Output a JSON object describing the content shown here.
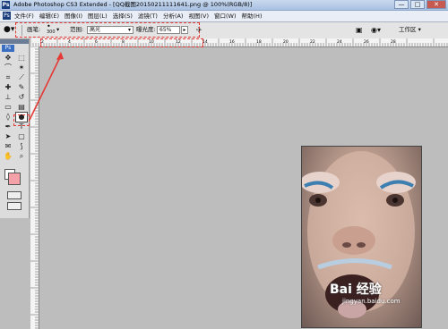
{
  "titlebar": {
    "logo": "Ps",
    "title": "Adobe Photoshop CS3 Extended - [QQ截图20150211111641.png @ 100%(RGB/8)]",
    "buttons": [
      "—",
      "□",
      "✕"
    ]
  },
  "menubar": {
    "items": [
      "文件(F)",
      "编辑(E)",
      "图像(I)",
      "图层(L)",
      "选择(S)",
      "滤镜(T)",
      "分析(A)",
      "视图(V)",
      "窗口(W)",
      "帮助(H)"
    ]
  },
  "options": {
    "brush_label": "画笔:",
    "brush_size": "300",
    "range_label": "范围:",
    "range_value": "高光",
    "exposure_label": "曝光度:",
    "exposure_value": "65%",
    "workspace": "工作区 ▾"
  },
  "ruler": {
    "ticks": [
      "2",
      "4",
      "6",
      "8",
      "10",
      "12",
      "14",
      "16",
      "18",
      "20",
      "22",
      "24",
      "26",
      "28"
    ]
  },
  "toolbox": {
    "badge": "Ps",
    "tools": [
      {
        "name": "move-tool-icon",
        "glyph": "✥"
      },
      {
        "name": "marquee-tool-icon",
        "glyph": "⬚"
      },
      {
        "name": "lasso-tool-icon",
        "glyph": "⌒"
      },
      {
        "name": "magic-wand-icon",
        "glyph": "✶"
      },
      {
        "name": "crop-tool-icon",
        "glyph": "⌗"
      },
      {
        "name": "slice-tool-icon",
        "glyph": "⟋"
      },
      {
        "name": "healing-brush-icon",
        "glyph": "✚"
      },
      {
        "name": "brush-tool-icon",
        "glyph": "✎"
      },
      {
        "name": "clone-stamp-icon",
        "glyph": "⊥"
      },
      {
        "name": "history-brush-icon",
        "glyph": "↺"
      },
      {
        "name": "eraser-tool-icon",
        "glyph": "▭"
      },
      {
        "name": "gradient-tool-icon",
        "glyph": "▤"
      },
      {
        "name": "blur-tool-icon",
        "glyph": "◊"
      },
      {
        "name": "dodge-tool-icon",
        "glyph": "●"
      },
      {
        "name": "pen-tool-icon",
        "glyph": "✒"
      },
      {
        "name": "type-tool-icon",
        "glyph": "T"
      },
      {
        "name": "path-select-icon",
        "glyph": "➤"
      },
      {
        "name": "shape-tool-icon",
        "glyph": "▢"
      },
      {
        "name": "notes-tool-icon",
        "glyph": "✉"
      },
      {
        "name": "eyedropper-icon",
        "glyph": "⟆"
      },
      {
        "name": "hand-tool-icon",
        "glyph": "✋"
      },
      {
        "name": "zoom-tool-icon",
        "glyph": "⌕"
      }
    ],
    "selected_tool": "dodge-tool-icon"
  },
  "colors": {
    "foreground": "#f4a1aa",
    "background": "#ffffff",
    "annotation": "#e53935"
  },
  "watermark": {
    "main": "Bai 经验",
    "url": "jingyan.baidu.com"
  }
}
